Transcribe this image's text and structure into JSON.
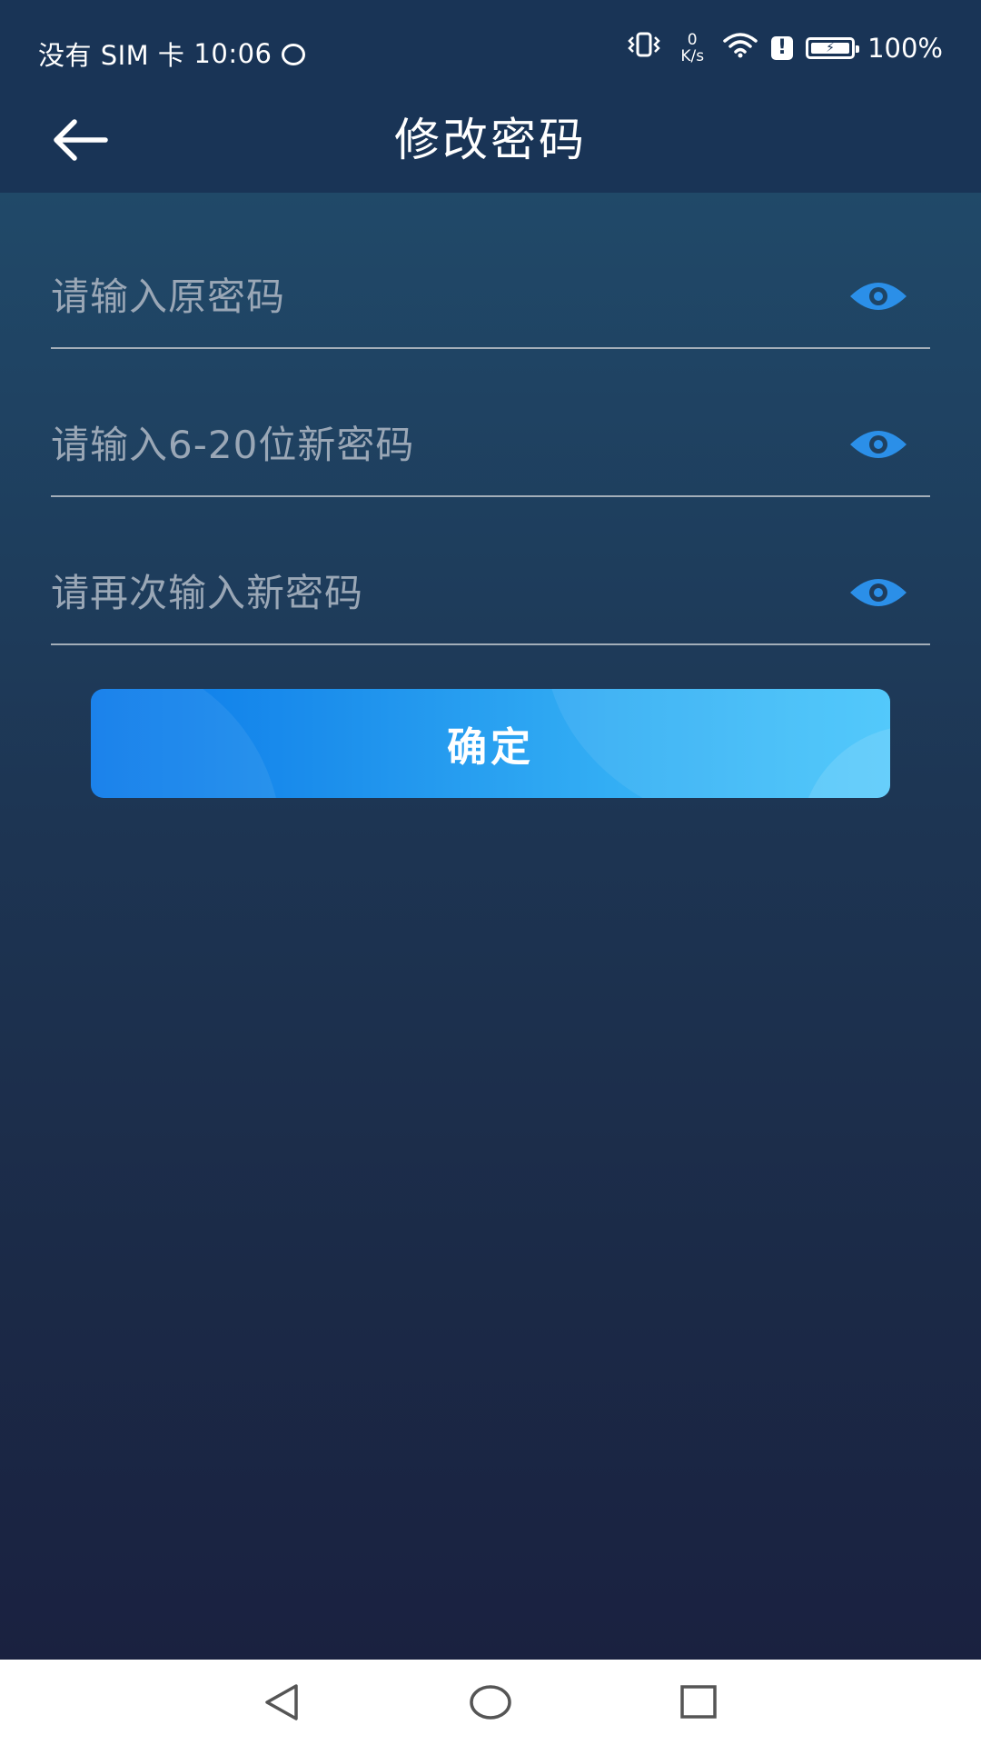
{
  "status_bar": {
    "carrier": "没有 SIM 卡",
    "time": "10:06",
    "net_speed_value": "0",
    "net_speed_unit": "K/s",
    "alert": "!",
    "battery_percent": "100%"
  },
  "header": {
    "title": "修改密码",
    "back_icon": "arrow-left-icon"
  },
  "form": {
    "old_password": {
      "placeholder": "请输入原密码",
      "value": ""
    },
    "new_password": {
      "placeholder": "请输入6-20位新密码",
      "value": ""
    },
    "confirm_password": {
      "placeholder": "请再次输入新密码",
      "value": ""
    },
    "eye_icon": "eye-icon",
    "submit_label": "确定"
  },
  "nav_bar": {
    "back_icon": "triangle-back-icon",
    "home_icon": "circle-home-icon",
    "recent_icon": "square-recents-icon"
  },
  "colors": {
    "header_bg": "#193456",
    "accent_blue": "#1a8cee",
    "eye_blue": "#2b8fe8",
    "placeholder": "#9aa7b6",
    "underline": "#a3aeb9"
  }
}
